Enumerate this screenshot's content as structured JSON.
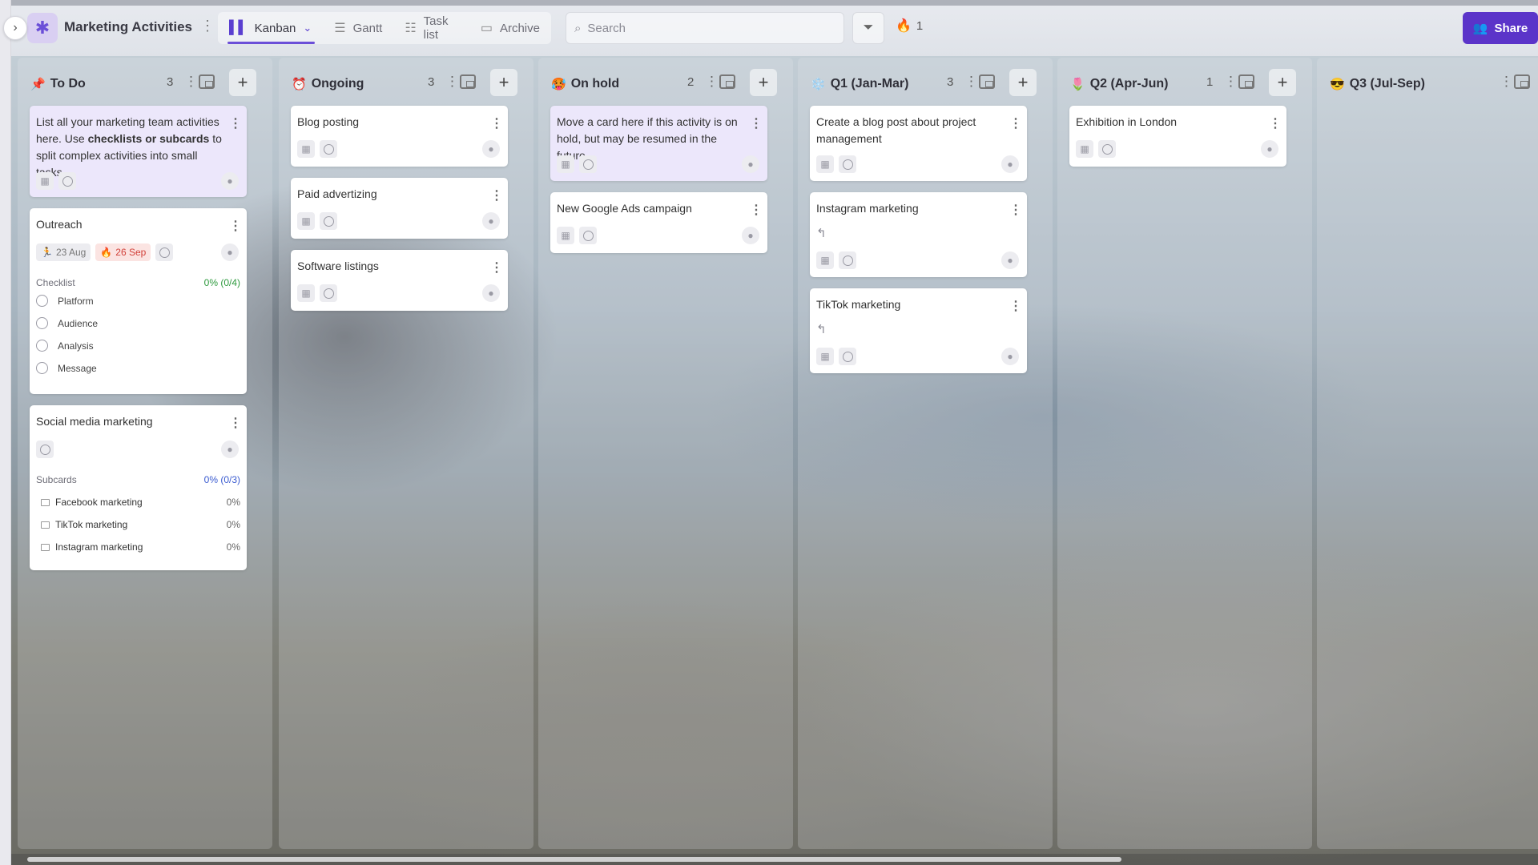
{
  "app": {
    "board_title": "Marketing Activities",
    "views": [
      {
        "label": "Kanban",
        "icon": "kanban-icon"
      },
      {
        "label": "Gantt",
        "icon": "gantt-icon"
      },
      {
        "label": "Task list",
        "icon": "list-icon"
      },
      {
        "label": "Archive",
        "icon": "archive-icon"
      }
    ],
    "search_placeholder": "Search",
    "hot_count": "1",
    "share_label": "Share",
    "accent_color": "#5b34c9"
  },
  "columns": [
    {
      "emoji": "📌",
      "title": "To Do",
      "count": "3",
      "cards": [
        {
          "title_pre": "List all your marketing team activities here. Use ",
          "title_bold": "checklists or subcards",
          "title_post": " to split complex activities into small tasks"
        },
        {
          "title": "Outreach",
          "start_date": "23 Aug",
          "due_date": "26 Sep",
          "checklist_label": "Checklist",
          "checklist_progress": "0% (0/4)",
          "checklist": [
            "Platform",
            "Audience",
            "Analysis",
            "Message"
          ]
        },
        {
          "title": "Social media marketing",
          "subcards_label": "Subcards",
          "subcards_progress": "0% (0/3)",
          "subcards": [
            {
              "name": "Facebook marketing",
              "progress": "0%"
            },
            {
              "name": "TikTok marketing",
              "progress": "0%"
            },
            {
              "name": "Instagram marketing",
              "progress": "0%"
            }
          ]
        }
      ]
    },
    {
      "emoji": "⏰",
      "title": "Ongoing",
      "count": "3",
      "cards": [
        {
          "title": "Blog posting"
        },
        {
          "title": "Paid advertizing"
        },
        {
          "title": "Software listings"
        }
      ]
    },
    {
      "emoji": "🥵",
      "title": "On hold",
      "count": "2",
      "cards": [
        {
          "title": "Move a card here if this activity is on hold, but may be resumed in the future"
        },
        {
          "title": "New Google Ads campaign"
        }
      ]
    },
    {
      "emoji": "❄️",
      "title": "Q1 (Jan-Mar)",
      "count": "3",
      "cards": [
        {
          "title": "Create a blog post about project management"
        },
        {
          "title": "Instagram marketing"
        },
        {
          "title": "TikTok marketing"
        }
      ]
    },
    {
      "emoji": "🌷",
      "title": "Q2 (Apr-Jun)",
      "count": "1",
      "cards": [
        {
          "title": "Exhibition in London"
        }
      ]
    },
    {
      "emoji": "😎",
      "title": "Q3 (Jul-Sep)",
      "count": "",
      "cards": []
    }
  ]
}
